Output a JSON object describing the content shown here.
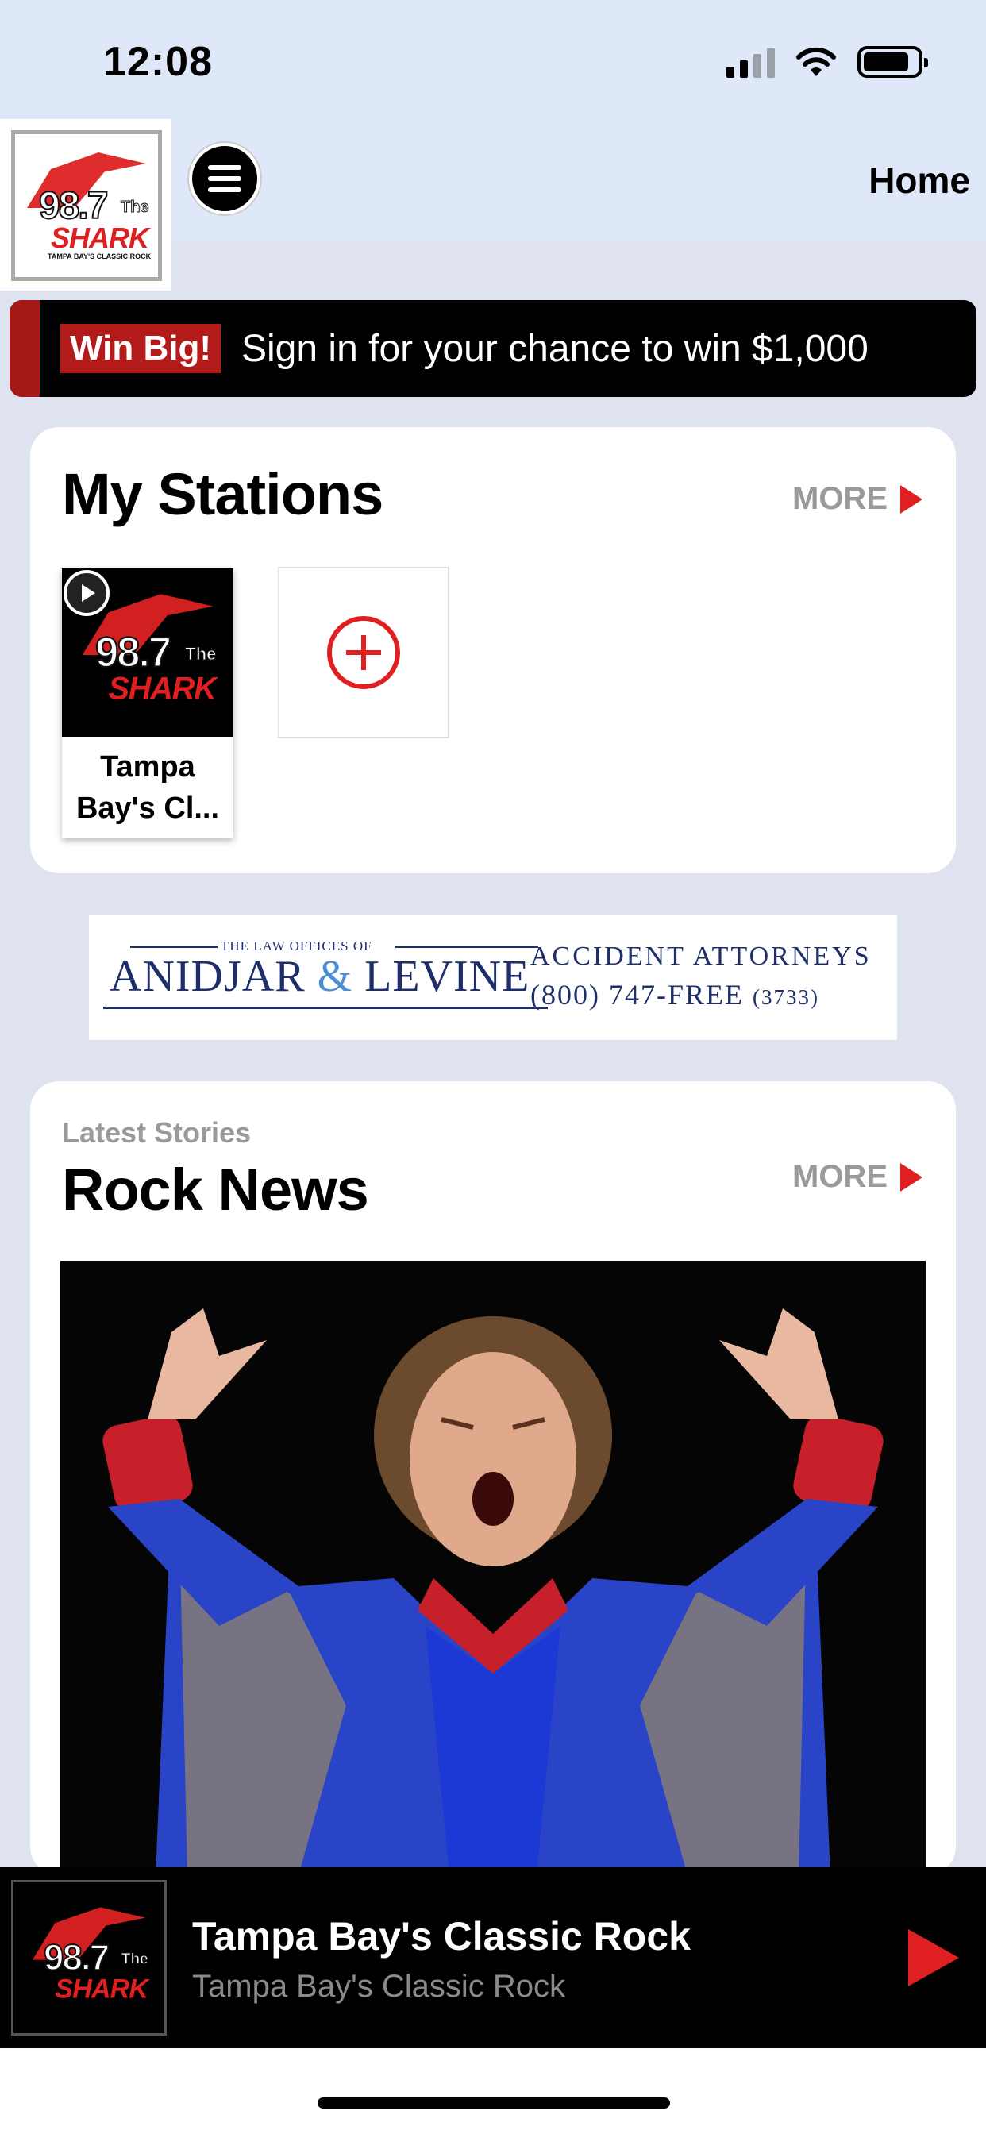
{
  "status_bar": {
    "time": "12:08"
  },
  "header": {
    "logo": {
      "number": "98.7",
      "the": "The",
      "word": "SHARK",
      "tagline": "TAMPA BAY'S CLASSIC ROCK"
    },
    "nav_label": "Home"
  },
  "promo": {
    "badge": "Win Big!",
    "text": "Sign in for your chance to win $1,000"
  },
  "my_stations": {
    "title": "My Stations",
    "more_label": "MORE",
    "stations": [
      {
        "name": "Tampa Bay's Cl..."
      }
    ]
  },
  "ad": {
    "small_line": "THE LAW OFFICES OF",
    "name_part1": "ANIDJAR",
    "amp": "&",
    "name_part2": "LEVINE",
    "line1": "ACCIDENT ATTORNEYS",
    "phone": "(800) 747-FREE",
    "phone_digits": "(3733)"
  },
  "news": {
    "subtitle": "Latest Stories",
    "title": "Rock News",
    "more_label": "MORE"
  },
  "player": {
    "title": "Tampa Bay's Classic Rock",
    "subtitle": "Tampa Bay's Classic Rock"
  },
  "colors": {
    "accent": "#e02020",
    "header_bg": "#dfe8f8",
    "page_bg": "#dfe3ef",
    "promo_badge": "#b31b1b"
  },
  "icons": [
    "signal-icon",
    "wifi-icon",
    "battery-icon",
    "menu-icon",
    "chevron-right-icon",
    "play-icon",
    "add-icon"
  ]
}
